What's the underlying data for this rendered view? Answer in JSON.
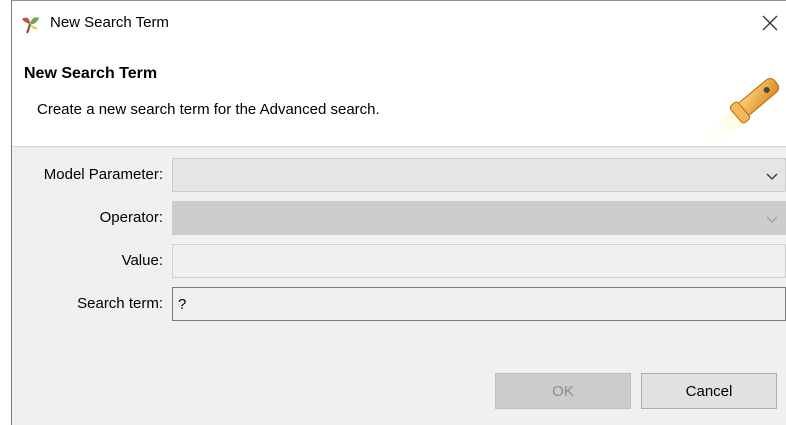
{
  "window": {
    "title": "New Search Term",
    "app_icon": "eclipse-leaf-icon",
    "close_icon": "close-icon"
  },
  "banner": {
    "title": "New Search Term",
    "description": "Create a new search term for the Advanced search.",
    "image_icon": "flashlight-icon"
  },
  "form": {
    "model_parameter": {
      "label": "Model Parameter:",
      "value": ""
    },
    "operator": {
      "label": "Operator:",
      "value": ""
    },
    "value": {
      "label": "Value:",
      "value": ""
    },
    "search_term": {
      "label": "Search term:",
      "value": "?"
    }
  },
  "buttons": {
    "ok": "OK",
    "cancel": "Cancel"
  },
  "colors": {
    "dialog_bg": "#f0f0f0",
    "disabled_field": "#cccccc",
    "button_bg": "#e1e1e1"
  }
}
